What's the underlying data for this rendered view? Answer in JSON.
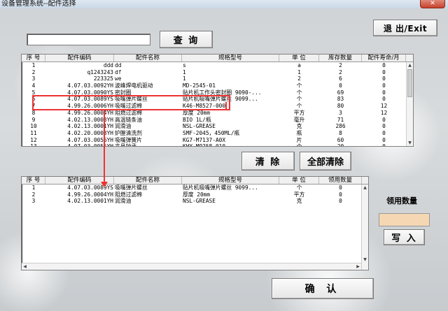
{
  "window": {
    "title": "设备管理系统--配件选择",
    "close_label": "✕"
  },
  "search": {
    "value": "",
    "button_label": "查 询"
  },
  "exit_label": "退 出/Exit",
  "top_table": {
    "columns": [
      "序 号",
      "配件编码",
      "配件名称",
      "规格型号",
      "单 位",
      "库存数量",
      "配件寿命/月"
    ],
    "rows": [
      [
        "1",
        "ddd",
        "dd",
        "s",
        "a",
        "2",
        "0"
      ],
      [
        "2",
        "q1243243",
        "df",
        "1",
        "1",
        "2",
        "0"
      ],
      [
        "3",
        "223325",
        "we",
        "1",
        "2",
        "6",
        "0"
      ],
      [
        "4",
        "4.07.03.0092YH",
        "波峰焊电机驱动",
        "MD-2545-01",
        "个",
        "0",
        "0"
      ],
      [
        "5",
        "4.07.03.0090YS",
        "密封圈",
        "贴片机工作头密封圈 9090-...",
        "个",
        "69",
        "0"
      ],
      [
        "6",
        "4.07.03.0089YS",
        "吸嘴弹片螺丝",
        "贴片机吸嘴弹片螺丝 9099...",
        "个",
        "83",
        "0"
      ],
      [
        "7",
        "4.99.26.0006YH",
        "吸嘴过滤棉",
        "K46-M8527-000",
        "个",
        "80",
        "12"
      ],
      [
        "8",
        "4.99.26.0004YH",
        "阻燃过滤棉",
        "厚度 20mm",
        "平方",
        "3",
        "12"
      ],
      [
        "9",
        "4.02.13.0003YH",
        "高温链条油",
        "BIO 1L/瓶",
        "毫升",
        "71",
        "0"
      ],
      [
        "10",
        "4.02.13.0001YH",
        "润滑油",
        "NSL-GREASE",
        "克",
        "286",
        "0"
      ],
      [
        "11",
        "4.02.20.0003YH",
        "炉膛清洗剂",
        "SMF-2045，450ML/瓶",
        "瓶",
        "8",
        "0"
      ],
      [
        "12",
        "4.07.03.0056YH",
        "吸嘴弹簧片",
        "KG7-M7137-A0X",
        "片",
        "60",
        "0"
      ],
      [
        "13",
        "4.07.03.0055YH",
        "夹具轴承",
        "KHY-M9258-010",
        "个",
        "20",
        "0"
      ]
    ]
  },
  "clear_label": "清 除",
  "clear_all_label": "全部清除",
  "bottom_table": {
    "columns": [
      "序 号",
      "配件编码",
      "配件名称",
      "规格型号",
      "单 位",
      "领用数量"
    ],
    "rows": [
      [
        "1",
        "4.07.03.0089YS",
        "吸嘴弹片螺丝",
        "贴片机吸嘴弹片螺丝 9099...",
        "个",
        "0"
      ],
      [
        "2",
        "4.99.26.0004YH",
        "阻燃过滤棉",
        "厚度 20mm",
        "平方",
        "0"
      ],
      [
        "3",
        "4.02.13.0001YH",
        "润滑油",
        "NSL-GREASE",
        "克",
        "0"
      ]
    ]
  },
  "qty_label": "领用数量",
  "qty_value": "",
  "write_label": "写 入",
  "confirm_label": "确 认",
  "colors": {
    "highlight": "#ee3333",
    "qty_input_bg": "#f6d7b3"
  }
}
